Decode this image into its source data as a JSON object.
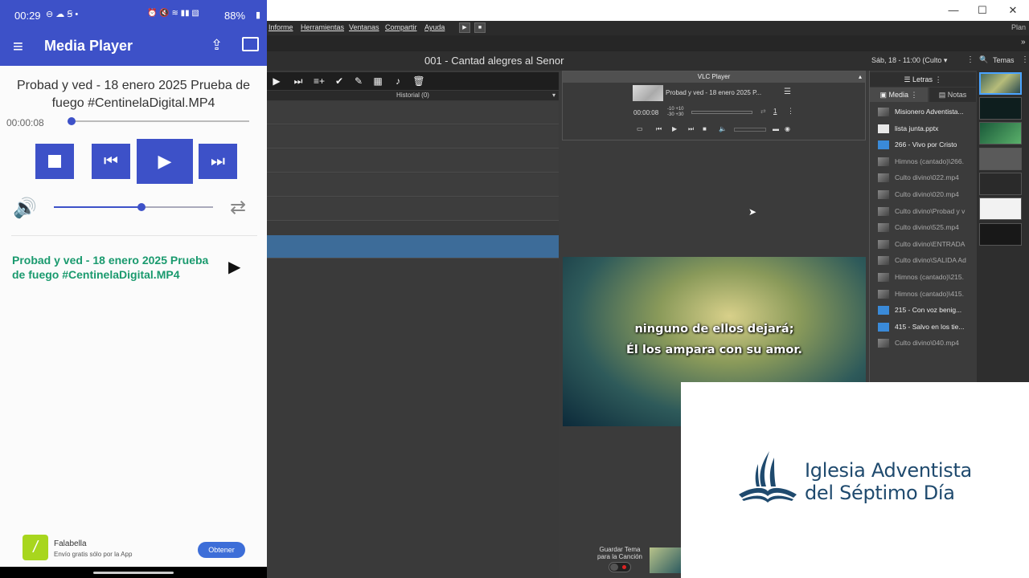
{
  "phone": {
    "status": {
      "time": "00:29",
      "battery": "88%"
    },
    "app_title": "Media Player",
    "now_playing": "Probad y ved - 18 enero 2025 Prueba de fuego #CentinelaDigital.MP4",
    "elapsed": "00:00:08",
    "progress_fraction": 0.02,
    "volume_fraction": 0.55,
    "playlist": [
      {
        "title": "Probad y ved - 18 enero 2025 Prueba de fuego #CentinelaDigital.MP4"
      }
    ],
    "ad": {
      "name": "Falabella",
      "subtitle": "Envío gratis sólo por la App",
      "button": "Obtener"
    },
    "brand_color": "#3d51c8"
  },
  "app": {
    "menu": [
      "Informe",
      "Herramientas",
      "Ventanas",
      "Compartir",
      "Ayuda"
    ],
    "plan_label": "Plan",
    "song_title": "001 - Cantad alegres al Senor",
    "date_info": "Sáb,  18 - 11:00  (Culto ▾",
    "themes_label": "Temas",
    "history_label": "Historial (0)",
    "vlc": {
      "header": "VLC Player",
      "title": "Probad y ved - 18 enero 2025 P...",
      "time": "00:00:08",
      "skip_labels": [
        "-10 +10",
        "-30 +30"
      ],
      "counter": "1"
    },
    "lyrics": [
      "ninguno de ellos dejará;",
      "Él los ampara con su amor."
    ],
    "save_theme_label": "Guardar Tema para la Canción",
    "letras_label": "Letras",
    "tabs": [
      "Media",
      "Notas"
    ],
    "media_items": [
      {
        "label": "Misionero Adventista...",
        "icon": "video-thumb",
        "white": true
      },
      {
        "label": "lista junta.pptx",
        "icon": "pptx-icon",
        "white": true
      },
      {
        "label": "266 - Vivo por Cristo",
        "icon": "song-icon",
        "white": true
      },
      {
        "label": "Himnos (cantado)\\266.",
        "icon": "video-thumb",
        "white": false
      },
      {
        "label": "Culto divino\\022.mp4",
        "icon": "video-thumb",
        "white": false
      },
      {
        "label": "Culto divino\\020.mp4",
        "icon": "video-thumb",
        "white": false
      },
      {
        "label": "Culto divino\\Probad y v",
        "icon": "video-thumb",
        "white": false
      },
      {
        "label": "Culto divino\\525.mp4",
        "icon": "video-thumb",
        "white": false
      },
      {
        "label": "Culto divino\\ENTRADA",
        "icon": "video-thumb",
        "white": false
      },
      {
        "label": "Culto divino\\SALIDA Ad",
        "icon": "video-thumb",
        "white": false
      },
      {
        "label": "Himnos (cantado)\\215.",
        "icon": "video-thumb",
        "white": false
      },
      {
        "label": "Himnos (cantado)\\415.",
        "icon": "video-thumb",
        "white": false
      },
      {
        "label": "215 - Con voz benig...",
        "icon": "song-icon",
        "white": true
      },
      {
        "label": "415 - Salvo en los tie...",
        "icon": "song-icon",
        "white": true
      },
      {
        "label": "Culto divino\\040.mp4",
        "icon": "video-thumb",
        "white": false
      }
    ]
  },
  "logo": {
    "line1": "Iglesia Adventista",
    "line2": "del Séptimo Día",
    "color": "#1f4a6e"
  }
}
